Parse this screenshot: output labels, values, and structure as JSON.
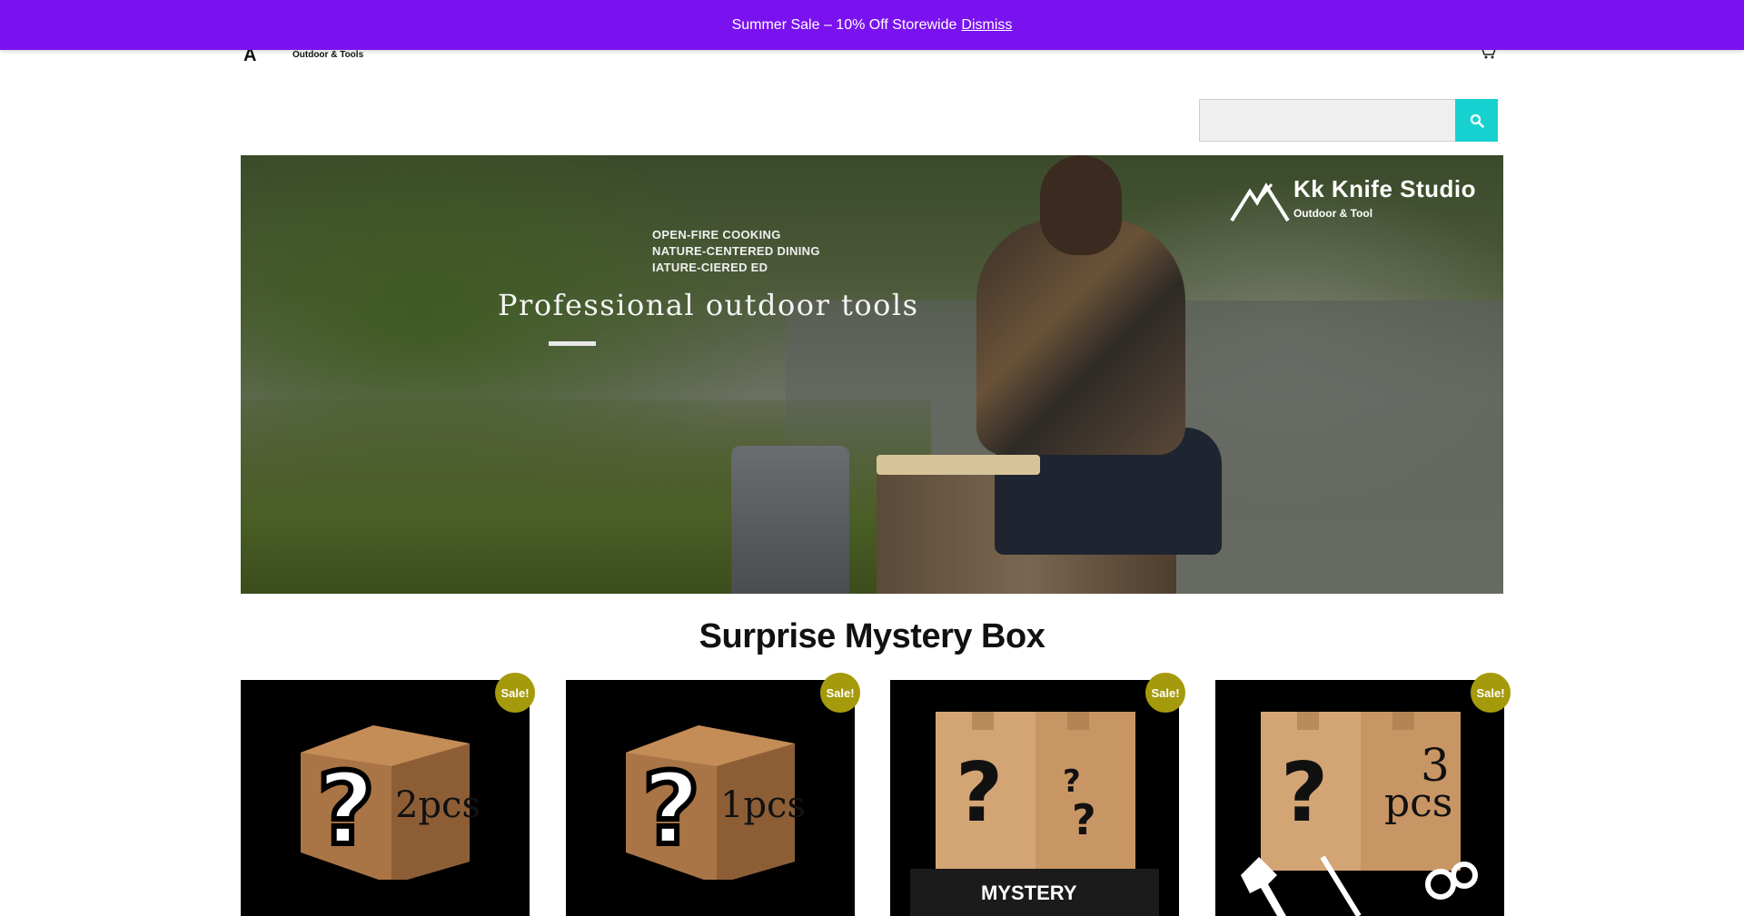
{
  "notice": {
    "text": "Summer Sale – 10% Off Storewide",
    "dismiss_label": "Dismiss"
  },
  "header": {
    "logo_mark": "A",
    "logo_tagline": "Outdoor & Tools"
  },
  "search": {
    "placeholder": "",
    "button_icon": "search-icon"
  },
  "hero": {
    "brand_name": "Kk Knife Studio",
    "brand_sub": "Outdoor & Tool",
    "taglines": [
      "OPEN-FIRE COOKING",
      "NATURE-CENTERED DINING",
      "IATURE-CIERED ED"
    ],
    "headline": "Professional outdoor tools"
  },
  "section": {
    "title": "Surprise Mystery Box"
  },
  "products": [
    {
      "badge": "Sale!",
      "label": "2pcs"
    },
    {
      "badge": "Sale!",
      "label": "1pcs"
    },
    {
      "badge": "Sale!",
      "label": "MYSTERY"
    },
    {
      "badge": "Sale!",
      "label": "3",
      "label2": "pcs"
    }
  ],
  "colors": {
    "notice_bg": "#7a12f0",
    "search_button": "#17d1d1",
    "sale_badge": "#a59a0b"
  }
}
